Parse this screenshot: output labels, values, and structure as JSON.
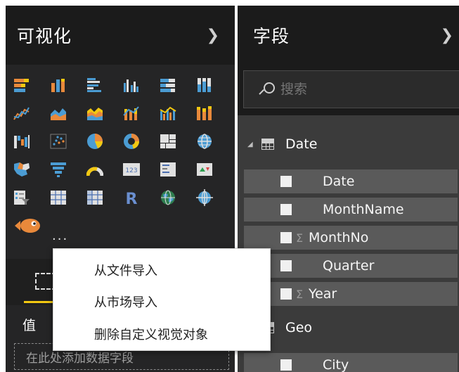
{
  "visualizations": {
    "title": "可视化",
    "icons": [
      "stacked-bar-chart-icon",
      "stacked-column-chart-icon",
      "clustered-bar-chart-icon",
      "clustered-column-chart-icon",
      "100-percent-stacked-bar-chart-icon",
      "100-percent-stacked-column-chart-icon",
      "line-chart-icon",
      "area-chart-icon",
      "stacked-area-chart-icon",
      "line-and-stacked-column-chart-icon",
      "line-and-clustered-column-chart-icon",
      "ribbon-chart-icon",
      "waterfall-chart-icon",
      "scatter-chart-icon",
      "pie-chart-icon",
      "donut-chart-icon",
      "treemap-icon",
      "map-icon",
      "filled-map-icon",
      "funnel-icon",
      "gauge-icon",
      "card-icon",
      "multi-row-card-icon",
      "kpi-icon",
      "slicer-icon",
      "table-icon",
      "matrix-icon",
      "r-script-visual-icon",
      "globe-map-icon",
      "arcgis-map-icon",
      "custom-fish-visual-icon"
    ],
    "more": "···",
    "values_label": "值",
    "values_placeholder": "在此处添加数据字段"
  },
  "fields": {
    "title": "字段",
    "search_placeholder": "搜索",
    "tables": [
      {
        "name": "Date",
        "fields": [
          {
            "name": "Date",
            "sigma": false
          },
          {
            "name": "MonthName",
            "sigma": false
          },
          {
            "name": "MonthNo",
            "sigma": true
          },
          {
            "name": "Quarter",
            "sigma": false
          },
          {
            "name": "Year",
            "sigma": true
          }
        ]
      },
      {
        "name": "Geo",
        "fields": [
          {
            "name": "City",
            "sigma": false
          }
        ]
      }
    ]
  },
  "context_menu": {
    "items": [
      "从文件导入",
      "从市场导入",
      "删除自定义视觉对象"
    ]
  },
  "colors": {
    "accent_yellow": "#f2c811",
    "blue": "#4b9cd3",
    "orange": "#e8893b",
    "pane_dark": "#252526",
    "field_row": "#5a5a5a"
  }
}
